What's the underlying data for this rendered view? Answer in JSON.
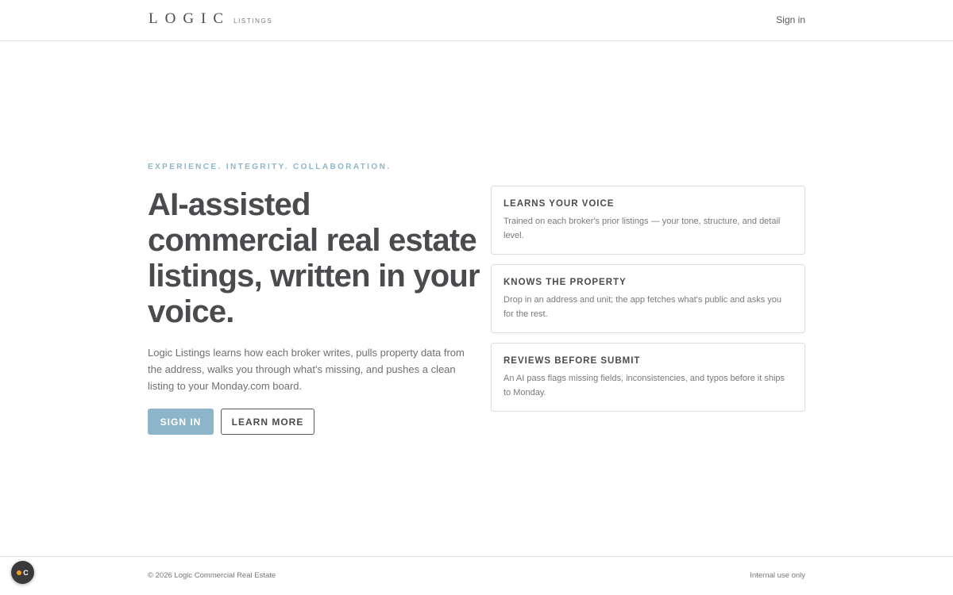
{
  "header": {
    "logo_main": "LOGIC",
    "logo_sub": "LISTINGS",
    "signin_label": "Sign in"
  },
  "hero": {
    "eyebrow": "EXPERIENCE. INTEGRITY. COLLABORATION.",
    "headline": "AI-assisted commercial real estate listings, written in your voice.",
    "lead": "Logic Listings learns how each broker writes, pulls property data from the address, walks you through what's missing, and pushes a clean listing to your Monday.com board.",
    "primary_button": "SIGN IN",
    "secondary_button": "LEARN MORE"
  },
  "features": [
    {
      "title": "LEARNS YOUR VOICE",
      "body": "Trained on each broker's prior listings — your tone, structure, and detail level."
    },
    {
      "title": "KNOWS THE PROPERTY",
      "body": "Drop in an address and unit; the app fetches what's public and asks you for the rest."
    },
    {
      "title": "REVIEWS BEFORE SUBMIT",
      "body": "An AI pass flags missing fields, inconsistencies, and typos before it ships to Monday."
    }
  ],
  "footer": {
    "copyright": "© 2026 Logic Commercial Real Estate",
    "note": "Internal use only"
  },
  "widget": {
    "letter": "C"
  },
  "colors": {
    "accent": "#8db5c9",
    "text": "#4b4b4f",
    "muted": "#7a7a7f",
    "border": "#dcdce0",
    "widget_dot": "#f0a21f"
  }
}
